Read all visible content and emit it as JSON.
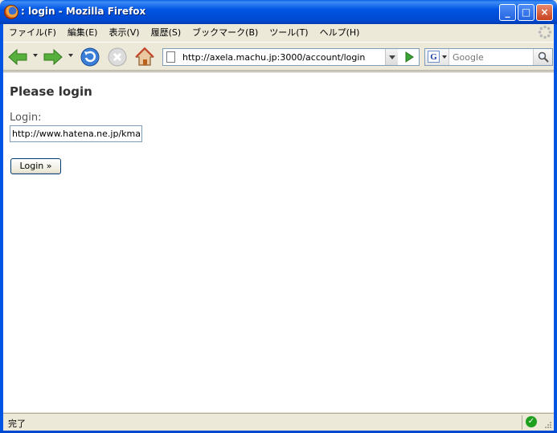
{
  "window": {
    "title": ": login - Mozilla Firefox",
    "controls": {
      "minimize": "_",
      "maximize": "□",
      "close": "×"
    }
  },
  "menu": {
    "items": [
      {
        "label": "ファイル(F)"
      },
      {
        "label": "編集(E)"
      },
      {
        "label": "表示(V)"
      },
      {
        "label": "履歴(S)"
      },
      {
        "label": "ブックマーク(B)"
      },
      {
        "label": "ツール(T)"
      },
      {
        "label": "ヘルプ(H)"
      }
    ]
  },
  "toolbar": {
    "icons": [
      "back-arrow",
      "forward-arrow",
      "reload",
      "stop",
      "home"
    ],
    "url": "http://axela.machu.jp:3000/account/login",
    "search": {
      "engine": "G",
      "placeholder": "Google"
    }
  },
  "page": {
    "heading": "Please login",
    "login_label": "Login:",
    "login_value": "http://www.hatena.ne.jp/kma",
    "submit_label": "Login »"
  },
  "status": {
    "text": "完了"
  },
  "colors": {
    "titlebar": "#0054e3",
    "chrome": "#ece9d8",
    "go_green": "#3aa335",
    "nav_green": "#58b03c",
    "reload_blue": "#3a7fd5"
  }
}
